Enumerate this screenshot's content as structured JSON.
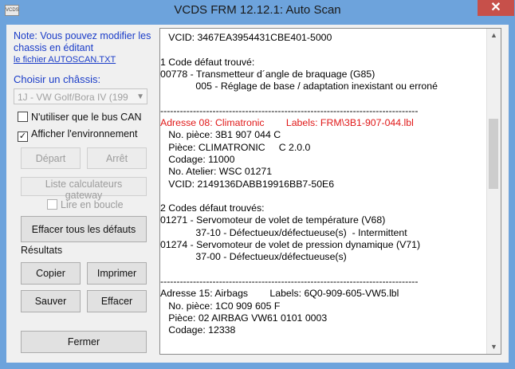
{
  "window": {
    "title": "VCDS FRM 12.12.1:  Auto Scan",
    "close_glyph": "✕",
    "app_icon_text": "VCDS"
  },
  "left": {
    "note": "Note:  Vous pouvez modifier les chassis en éditant",
    "note_link": "le fichier AUTOSCAN.TXT",
    "chassis_label": "Choisir un châssis:",
    "chassis_value": "1J - VW Golf/Bora IV (199",
    "chk_can_label": "N'utiliser que le bus CAN",
    "chk_env_label": "Afficher l'environnement",
    "chk_env_mark": "✓",
    "btn_depart": "Départ",
    "btn_arret": "Arrêt",
    "btn_gateway": "Liste calculateurs gateway",
    "chk_loop_label": "Lire en boucle",
    "btn_clear_all": "Effacer tous les défauts",
    "results_label": "Résultats",
    "btn_copy": "Copier",
    "btn_print": "Imprimer",
    "btn_save": "Sauver",
    "btn_erase": "Effacer",
    "btn_close": "Fermer"
  },
  "report": {
    "lines": [
      {
        "text": "   VCID: 3467EA3954431CBE401-5000",
        "color": "normal"
      },
      {
        "text": "",
        "color": "normal"
      },
      {
        "text": "1 Code défaut trouvé:",
        "color": "normal"
      },
      {
        "text": "00778 - Transmetteur d´angle de braquage (G85)",
        "color": "normal"
      },
      {
        "text": "             005 - Réglage de base / adaptation inexistant ou erroné",
        "color": "normal"
      },
      {
        "text": "",
        "color": "normal"
      },
      {
        "text": "-------------------------------------------------------------------------------",
        "color": "normal"
      },
      {
        "text": "Adresse 08: Climatronic        Labels: FRM\\3B1-907-044.lbl",
        "color": "red"
      },
      {
        "text": "   No. pièce: 3B1 907 044 C",
        "color": "normal"
      },
      {
        "text": "   Pièce: CLIMATRONIC     C 2.0.0",
        "color": "normal"
      },
      {
        "text": "   Codage: 11000",
        "color": "normal"
      },
      {
        "text": "   No. Atelier: WSC 01271",
        "color": "normal"
      },
      {
        "text": "   VCID: 2149136DABB19916BB7-50E6",
        "color": "normal"
      },
      {
        "text": "",
        "color": "normal"
      },
      {
        "text": "2 Codes défaut trouvés:",
        "color": "normal"
      },
      {
        "text": "01271 - Servomoteur de volet de température (V68)",
        "color": "normal"
      },
      {
        "text": "             37-10 - Défectueux/défectueuse(s)  - Intermittent",
        "color": "normal"
      },
      {
        "text": "01274 - Servomoteur de volet de pression dynamique (V71)",
        "color": "normal"
      },
      {
        "text": "             37-00 - Défectueux/défectueuse(s)",
        "color": "normal"
      },
      {
        "text": "",
        "color": "normal"
      },
      {
        "text": "-------------------------------------------------------------------------------",
        "color": "normal"
      },
      {
        "text": "Adresse 15: Airbags        Labels: 6Q0-909-605-VW5.lbl",
        "color": "normal"
      },
      {
        "text": "   No. pièce: 1C0 909 605 F",
        "color": "normal"
      },
      {
        "text": "   Pièce: 02 AIRBAG VW61 0101 0003",
        "color": "normal"
      },
      {
        "text": "   Codage: 12338",
        "color": "normal"
      }
    ]
  },
  "colors": {
    "window_frame": "#6da3dc",
    "note_blue": "#1a3cc8",
    "highlight_red": "#e01818",
    "close_red": "#c7504a"
  },
  "icons": {
    "scroll_up": "▲",
    "scroll_down": "▼",
    "combo_arrow": "▼"
  }
}
